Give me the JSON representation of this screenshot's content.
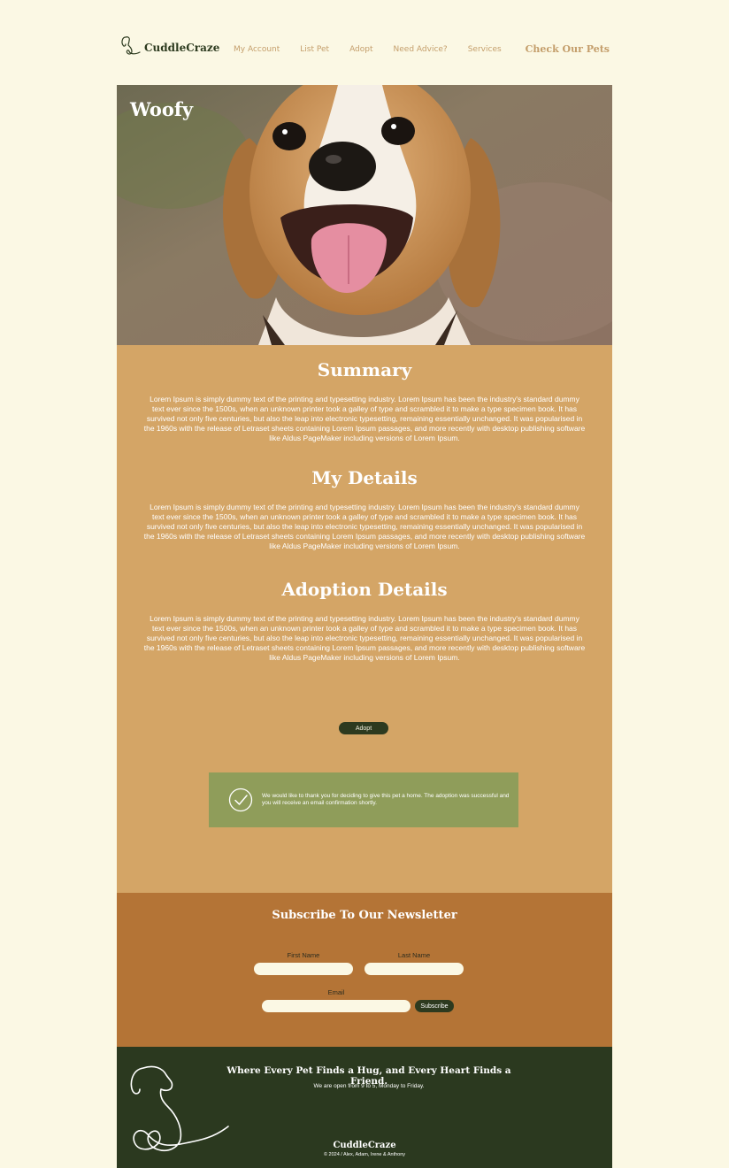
{
  "header": {
    "logo_text": "CuddleCraze",
    "nav": [
      "My Account",
      "List Pet",
      "Adopt",
      "Need Advice?",
      "Services"
    ],
    "cta": "Check Our Pets"
  },
  "hero": {
    "pet_name": "Woofy"
  },
  "sections": [
    {
      "title": "Summary",
      "body": "Lorem Ipsum is simply dummy text of the printing and typesetting industry. Lorem Ipsum has been the industry's standard dummy text ever since the 1500s, when an unknown printer took a galley of type and scrambled it to make a type specimen book. It has survived not only five centuries, but also the leap into electronic typesetting, remaining essentially unchanged. It was popularised in the 1960s with the release of Letraset sheets containing Lorem Ipsum passages, and more recently with desktop publishing software like Aldus PageMaker including versions of Lorem Ipsum."
    },
    {
      "title": "My Details",
      "body": "Lorem Ipsum is simply dummy text of the printing and typesetting industry. Lorem Ipsum has been the industry's standard dummy text ever since the 1500s, when an unknown printer took a galley of type and scrambled it to make a type specimen book. It has survived not only five centuries, but also the leap into electronic typesetting, remaining essentially unchanged. It was popularised in the 1960s with the release of Letraset sheets containing Lorem Ipsum passages, and more recently with desktop publishing software like Aldus PageMaker including versions of Lorem Ipsum."
    },
    {
      "title": "Adoption Details",
      "body": "Lorem Ipsum is simply dummy text of the printing and typesetting industry. Lorem Ipsum has been the industry's standard dummy text ever since the 1500s, when an unknown printer took a galley of type and scrambled it to make a type specimen book. It has survived not only five centuries, but also the leap into electronic typesetting, remaining essentially unchanged. It was popularised in the 1960s with the release of Letraset sheets containing Lorem Ipsum passages, and more recently with desktop publishing software like Aldus PageMaker including versions of Lorem Ipsum."
    }
  ],
  "adopt_button": "Adopt",
  "toast": {
    "icon": "check-circle-icon",
    "message": "We would like to thank you for deciding to give this pet a home. The adoption was successful and you will receive an email confirmation shortly."
  },
  "newsletter": {
    "title": "Subscribe To Our Newsletter",
    "first_name_label": "First Name",
    "last_name_label": "Last Name",
    "email_label": "Email",
    "first_name_value": "",
    "last_name_value": "",
    "email_value": "",
    "subscribe_label": "Subscribe"
  },
  "footer": {
    "tagline": "Where Every Pet Finds a Hug, and Every Heart Finds a Friend.",
    "hours": "We are open from 9 to 5, Monday to Friday.",
    "brand": "CuddleCraze",
    "copyright": "© 2024 / Alex, Adam, Irene & Anthony"
  },
  "colors": {
    "background": "#fbf8e4",
    "accent": "#c49e6b",
    "content_panel": "#d4a566",
    "newsletter_panel": "#b47436",
    "footer": "#2b391f",
    "success": "#8f9d5a",
    "button": "#2d3a1f"
  }
}
